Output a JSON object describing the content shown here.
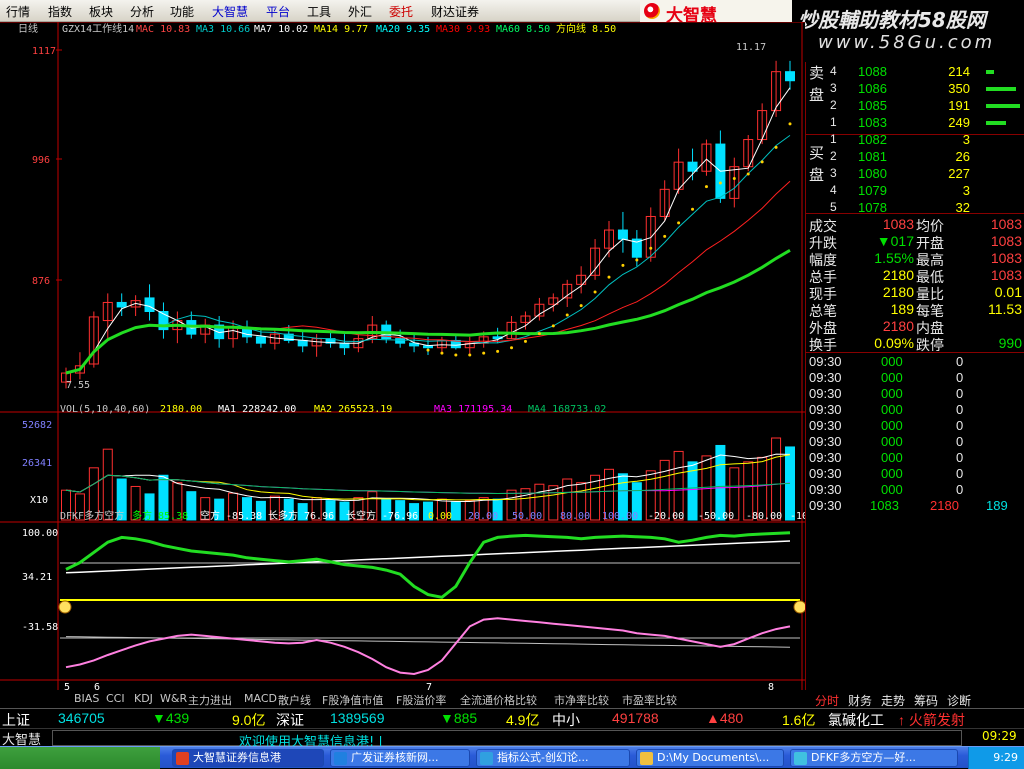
{
  "menu": {
    "items": [
      "行情",
      "指数",
      "板块",
      "分析",
      "功能",
      "大智慧",
      "平台",
      "工具",
      "外汇",
      "委托",
      "财达证券"
    ],
    "colors": [
      "#000",
      "#000",
      "#000",
      "#000",
      "#000",
      "#0000cc",
      "#0000cc",
      "#000",
      "#000",
      "#cc0000",
      "#000"
    ]
  },
  "brand": {
    "name": "大智慧"
  },
  "banner": {
    "line1": "炒股輔助教材58股网",
    "line2": "www.58Gu.com"
  },
  "kline": {
    "period_label": "日线",
    "header_prefix": "GZX14工作线14",
    "ma_legend": [
      {
        "text": "MAC 10.83",
        "color": "#ff4444"
      },
      {
        "text": "MA3 10.66",
        "color": "#00cccc"
      },
      {
        "text": "MA7 10.02",
        "color": "#ffffff"
      },
      {
        "text": "MA14 9.77",
        "color": "#ffff00"
      },
      {
        "text": "MA20 9.35",
        "color": "#00ffff"
      },
      {
        "text": "MA30 9.93",
        "color": "#ff0000"
      },
      {
        "text": "MA60 8.50",
        "color": "#00ff66"
      },
      {
        "text": "方向线 8.50",
        "color": "#ffff00"
      }
    ],
    "price_ticks": [
      "1117",
      "996",
      "876"
    ],
    "high_label": "11.17",
    "low_label": "7.55",
    "colors": {
      "up": "#ff3030",
      "down": "#00e0ff",
      "ma_fast": "#ffffff",
      "ma_mid": "#00c0c0",
      "ma_slow": "#ff2020",
      "ma60": "#22dd22",
      "dots": "#ffd000"
    }
  },
  "volume": {
    "header": [
      {
        "text": "VOL(5,10,40,60)",
        "color": "#c8c8c8"
      },
      {
        "text": "2180.00",
        "color": "#ffff00"
      },
      {
        "text": "MA1 228242.00",
        "color": "#ffffff"
      },
      {
        "text": "MA2 265523.19",
        "color": "#ffff00"
      },
      {
        "text": "MA3 171195.34",
        "color": "#ff00ff"
      },
      {
        "text": "MA4 168733.02",
        "color": "#00c060"
      }
    ],
    "ticks": [
      "52682",
      "26341",
      "X10"
    ]
  },
  "indicator": {
    "header": [
      {
        "text": "DFKF多方空方",
        "color": "#c8c8c8"
      },
      {
        "text": "多方 85.38",
        "color": "#00ff00"
      },
      {
        "text": "空方 -85.38",
        "color": "#ffffff"
      },
      {
        "text": "长多方 76.96",
        "color": "#ffffff"
      },
      {
        "text": "长空方 -76.96",
        "color": "#ffffff"
      },
      {
        "text": "0.00",
        "color": "#ffff00"
      },
      {
        "text": "20.00",
        "color": "#8080ff"
      },
      {
        "text": "50.00",
        "color": "#8080ff"
      },
      {
        "text": "80.00",
        "color": "#8080ff"
      },
      {
        "text": "100.00",
        "color": "#8080ff"
      },
      {
        "text": "-20.00",
        "color": "#ffffff"
      },
      {
        "text": "-50.00",
        "color": "#ffffff"
      },
      {
        "text": "-80.00",
        "color": "#ffffff"
      },
      {
        "text": "-10",
        "color": "#ffffff"
      }
    ],
    "ticks": [
      "100.00",
      "34.21",
      "-31.58"
    ],
    "date_ticks": [
      "5",
      "6",
      "7",
      "8"
    ]
  },
  "bottom_tabs": [
    "BIAS",
    "CCI",
    "KDJ",
    "W&R",
    "主力进出",
    "MACD",
    "散户线",
    "F股净值市值",
    "F股溢价率",
    "全流通价格比较",
    "市净率比较",
    "市盈率比较"
  ],
  "quote": {
    "ask_label": "卖盘",
    "bid_label": "买盘",
    "asks": [
      {
        "level": "4",
        "price": "1088",
        "vol": "214"
      },
      {
        "level": "3",
        "price": "1086",
        "vol": "350"
      },
      {
        "level": "2",
        "price": "1085",
        "vol": "191"
      },
      {
        "level": "1",
        "price": "1083",
        "vol": "249"
      }
    ],
    "bids": [
      {
        "level": "1",
        "price": "1082",
        "vol": "3"
      },
      {
        "level": "2",
        "price": "1081",
        "vol": "26"
      },
      {
        "level": "3",
        "price": "1080",
        "vol": "227"
      },
      {
        "level": "4",
        "price": "1079",
        "vol": "3"
      },
      {
        "level": "5",
        "price": "1078",
        "vol": "32"
      }
    ],
    "stats": [
      {
        "l1": "成交",
        "v1": "1083",
        "l2": "均价",
        "v2": "1083",
        "c1": "#ff4040",
        "c2": "#ff4040"
      },
      {
        "l1": "升跌",
        "v1": "▼017",
        "l2": "开盘",
        "v2": "1083",
        "c1": "#00e000",
        "c2": "#ff4040"
      },
      {
        "l1": "幅度",
        "v1": "1.55%",
        "l2": "最高",
        "v2": "1083",
        "c1": "#00e000",
        "c2": "#ff4040"
      },
      {
        "l1": "总手",
        "v1": "2180",
        "l2": "最低",
        "v2": "1083",
        "c1": "#ffff00",
        "c2": "#ff4040"
      },
      {
        "l1": "现手",
        "v1": "2180",
        "l2": "量比",
        "v2": "0.01",
        "c1": "#ffff00",
        "c2": "#ffff00"
      },
      {
        "l1": "总笔",
        "v1": "189",
        "l2": "每笔",
        "v2": "11.53",
        "c1": "#ffff00",
        "c2": "#ffff00"
      },
      {
        "l1": "外盘",
        "v1": "2180",
        "l2": "内盘",
        "v2": "",
        "c1": "#ff4040",
        "c2": "#00e000"
      },
      {
        "l1": "换手",
        "v1": "0.09%",
        "l2": "跌停",
        "v2": "990",
        "c1": "#ffff00",
        "c2": "#00e000"
      }
    ],
    "ticks": [
      {
        "time": "09:30",
        "price": "000",
        "vol": "0"
      },
      {
        "time": "09:30",
        "price": "000",
        "vol": "0"
      },
      {
        "time": "09:30",
        "price": "000",
        "vol": "0"
      },
      {
        "time": "09:30",
        "price": "000",
        "vol": "0"
      },
      {
        "time": "09:30",
        "price": "000",
        "vol": "0"
      },
      {
        "time": "09:30",
        "price": "000",
        "vol": "0"
      },
      {
        "time": "09:30",
        "price": "000",
        "vol": "0"
      },
      {
        "time": "09:30",
        "price": "000",
        "vol": "0"
      },
      {
        "time": "09:30",
        "price": "000",
        "vol": "0"
      }
    ],
    "last_tick": {
      "time": "09:30",
      "price": "1083",
      "vol": "2180",
      "count": "189"
    }
  },
  "panel_tabs": [
    "分时",
    "财务",
    "走势",
    "筹码",
    "诊断"
  ],
  "index_bar": {
    "sh_label": "上证",
    "sh_value": "346705",
    "sh_change": "▼439",
    "sh_amount": "9.0亿",
    "sz_label": "深证",
    "sz_value": "1389569",
    "sz_change": "▼885",
    "sz_amount": "4.9亿",
    "zx_label": "中小",
    "zx_value": "491788",
    "zx_change": "▲480",
    "zx_amount": "1.6亿",
    "stock_name": "氯碱化工",
    "signal": "↑ 火箭发射"
  },
  "status": {
    "app": "大智慧",
    "scroll": "欢迎使用大智慧信息港! |",
    "time": "09:29"
  },
  "taskbar": {
    "items": [
      "大智慧证券信息港",
      "广发证券核新网...",
      "指标公式-创幻论...",
      "D:\\My Documents\\...",
      "DFKF多方空方—好..."
    ],
    "clock": "9:29"
  }
}
